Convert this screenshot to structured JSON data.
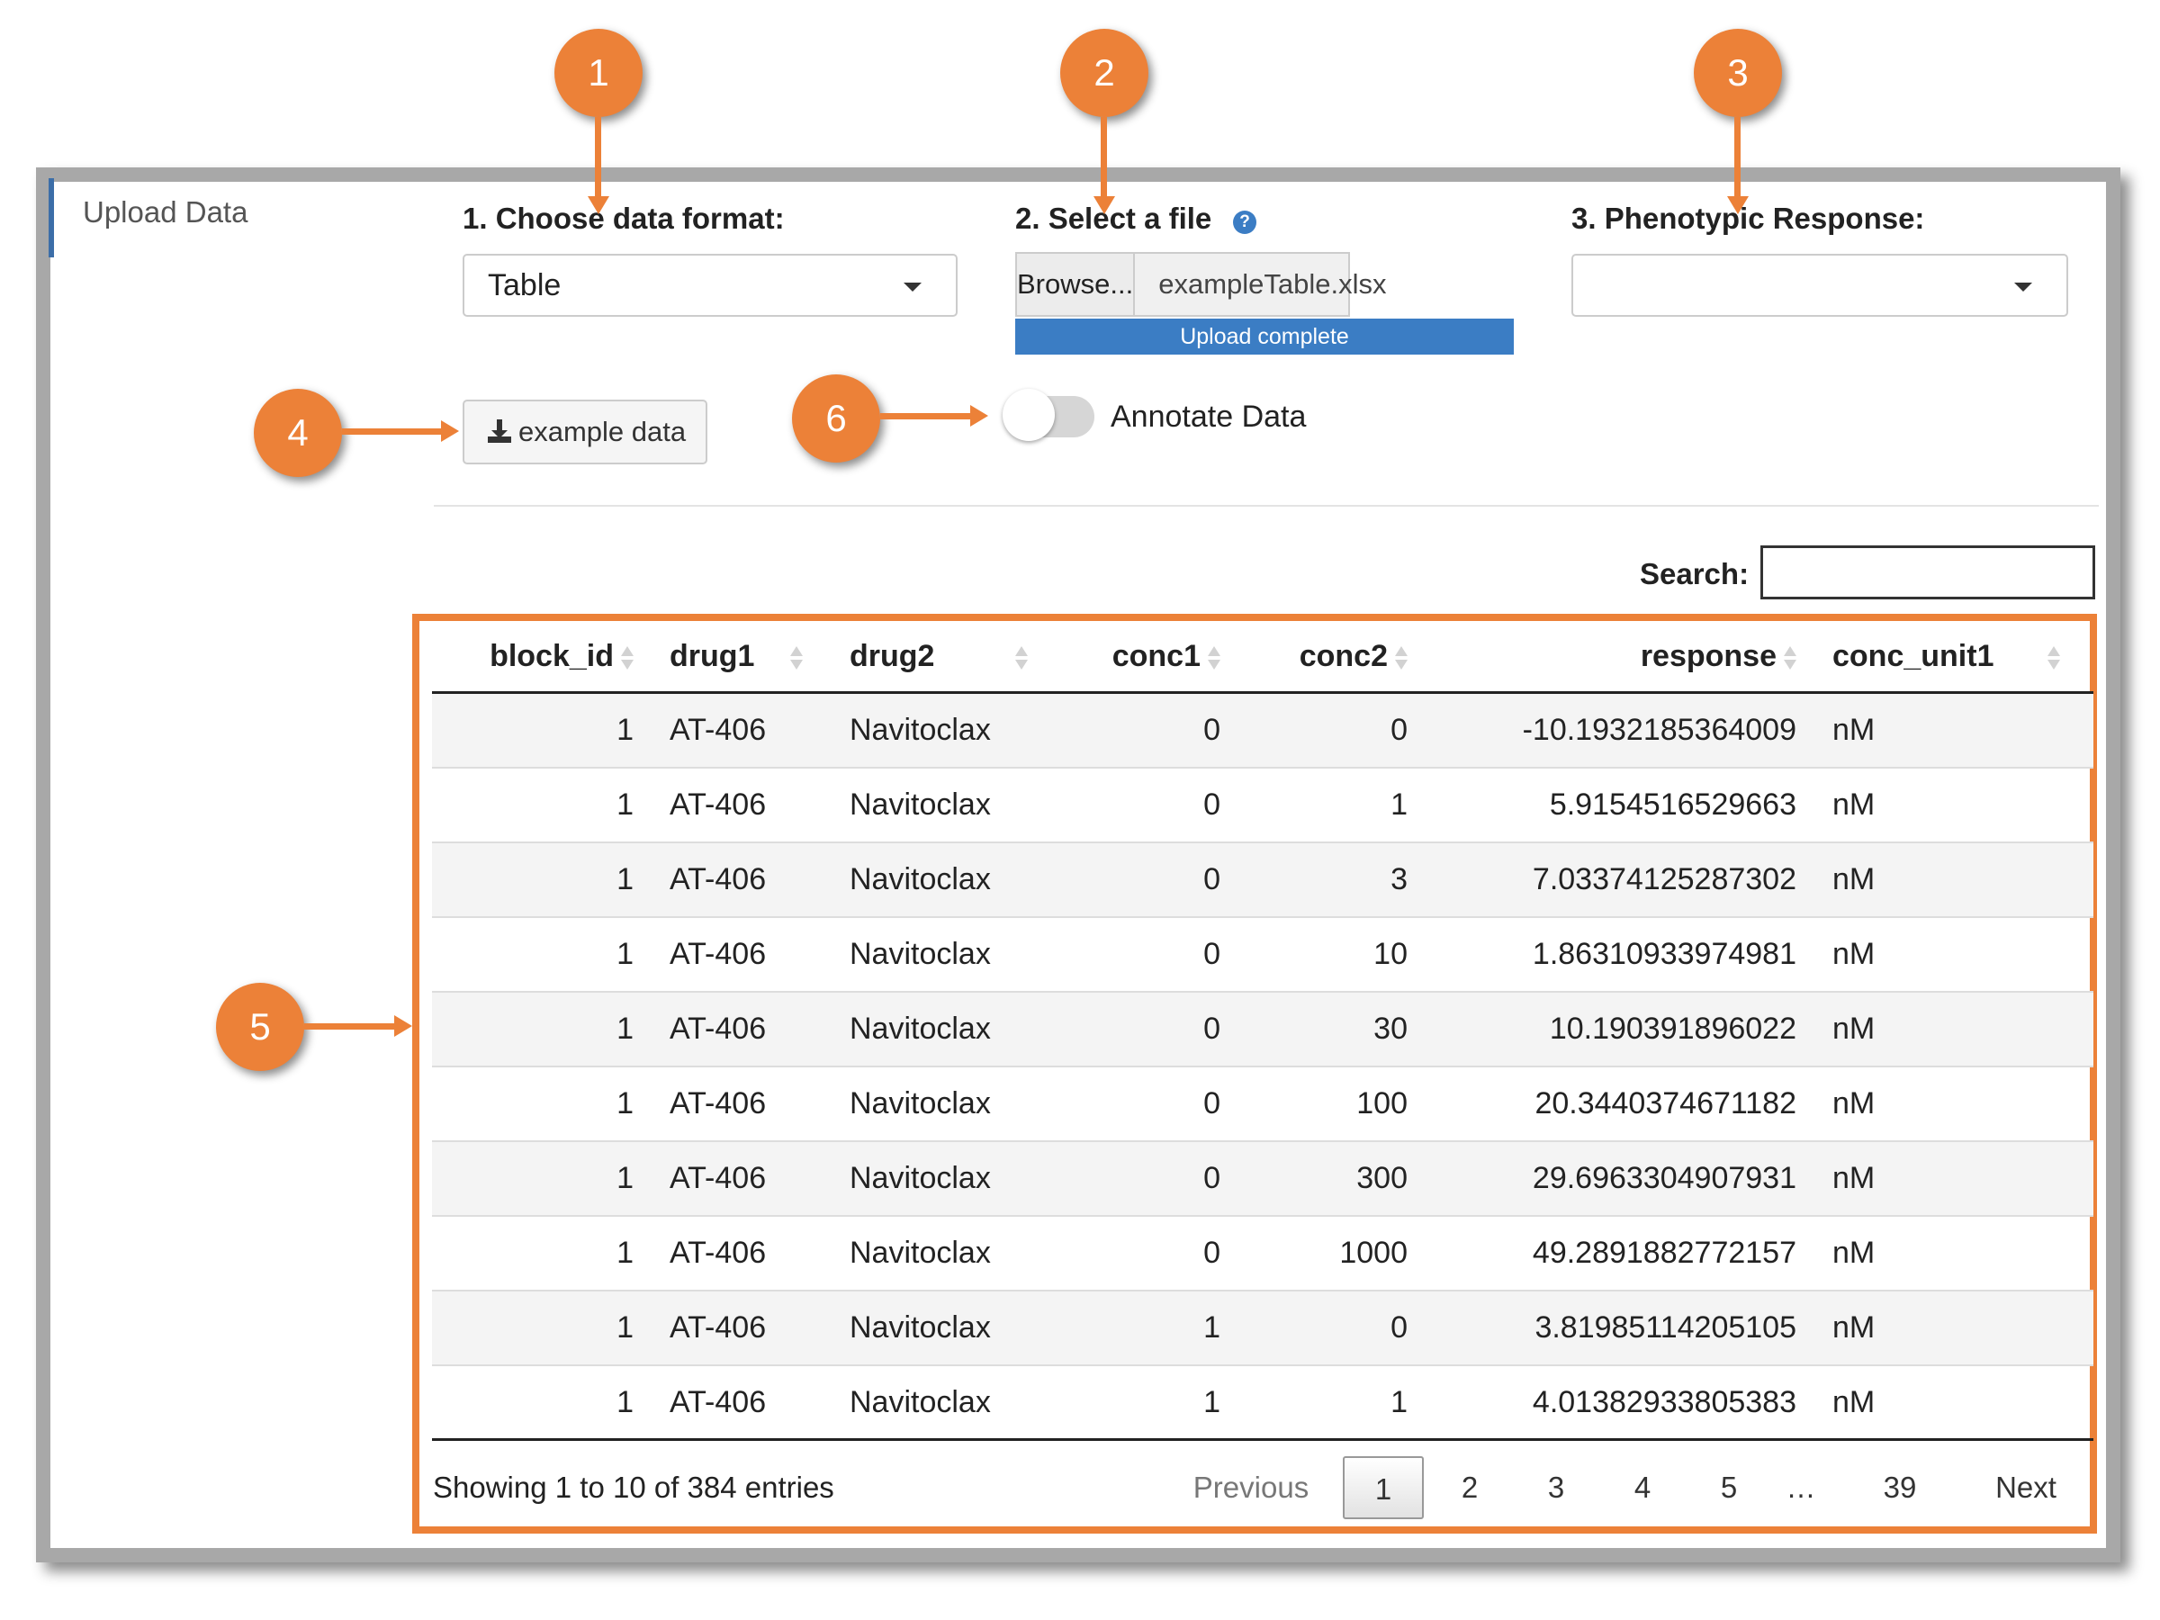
{
  "sidebar": {
    "tab_label": "Upload Data"
  },
  "format": {
    "label": "1. Choose data format:",
    "selected": "Table"
  },
  "file": {
    "label": "2. Select a file",
    "help_icon": "?",
    "browse_label": "Browse...",
    "filename": "exampleTable.xlsx",
    "progress_text": "Upload complete",
    "progress_fraction": 1.0
  },
  "phenotypic": {
    "label": "3. Phenotypic Response:",
    "selected": ""
  },
  "example_button": {
    "label": "example data",
    "icon": "download-icon"
  },
  "annotate": {
    "label": "Annotate Data",
    "on": false
  },
  "search": {
    "label": "Search:",
    "value": ""
  },
  "table": {
    "columns": [
      "block_id",
      "drug1",
      "drug2",
      "conc1",
      "conc2",
      "response",
      "conc_unit1"
    ],
    "rows": [
      [
        "1",
        "AT-406",
        "Navitoclax",
        "0",
        "0",
        "-10.1932185364009",
        "nM"
      ],
      [
        "1",
        "AT-406",
        "Navitoclax",
        "0",
        "1",
        "5.9154516529663",
        "nM"
      ],
      [
        "1",
        "AT-406",
        "Navitoclax",
        "0",
        "3",
        "7.03374125287302",
        "nM"
      ],
      [
        "1",
        "AT-406",
        "Navitoclax",
        "0",
        "10",
        "1.86310933974981",
        "nM"
      ],
      [
        "1",
        "AT-406",
        "Navitoclax",
        "0",
        "30",
        "10.190391896022",
        "nM"
      ],
      [
        "1",
        "AT-406",
        "Navitoclax",
        "0",
        "100",
        "20.3440374671182",
        "nM"
      ],
      [
        "1",
        "AT-406",
        "Navitoclax",
        "0",
        "300",
        "29.6963304907931",
        "nM"
      ],
      [
        "1",
        "AT-406",
        "Navitoclax",
        "0",
        "1000",
        "49.2891882772157",
        "nM"
      ],
      [
        "1",
        "AT-406",
        "Navitoclax",
        "1",
        "0",
        "3.81985114205105",
        "nM"
      ],
      [
        "1",
        "AT-406",
        "Navitoclax",
        "1",
        "1",
        "4.01382933805383",
        "nM"
      ]
    ],
    "info": "Showing 1 to 10 of 384 entries"
  },
  "pagination": {
    "previous": "Previous",
    "pages": [
      "1",
      "2",
      "3",
      "4",
      "5",
      "…",
      "39"
    ],
    "current": "1",
    "next": "Next"
  },
  "annotations": {
    "m1": "1",
    "m2": "2",
    "m3": "3",
    "m4": "4",
    "m5": "5",
    "m6": "6"
  },
  "colors": {
    "accent": "#ec8138",
    "primary": "#3b7dc4"
  }
}
